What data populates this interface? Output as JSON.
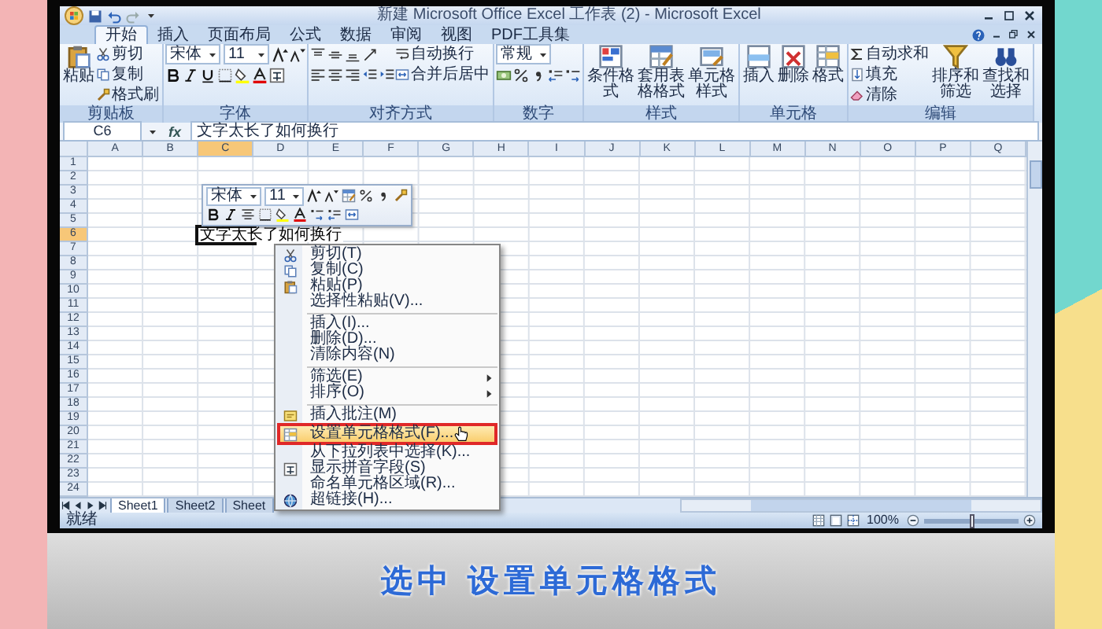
{
  "window": {
    "title": "新建 Microsoft Office Excel 工作表 (2) - Microsoft Excel"
  },
  "tabs": [
    {
      "label": "开始",
      "selected": true
    },
    {
      "label": "插入",
      "selected": false
    },
    {
      "label": "页面布局",
      "selected": false
    },
    {
      "label": "公式",
      "selected": false
    },
    {
      "label": "数据",
      "selected": false
    },
    {
      "label": "审阅",
      "selected": false
    },
    {
      "label": "视图",
      "selected": false
    },
    {
      "label": "PDF工具集",
      "selected": false
    }
  ],
  "ribbon": {
    "groups": [
      {
        "label": "剪贴板",
        "columns": [
          [
            {
              "kind": "large",
              "label": "粘贴"
            }
          ],
          [
            {
              "kind": "small",
              "label": "剪切"
            },
            {
              "kind": "small",
              "label": "复制"
            },
            {
              "kind": "small",
              "label": "格式刷"
            }
          ]
        ]
      },
      {
        "label": "字体",
        "columns": [
          [
            [
              {
                "kind": "select",
                "value": "宋体"
              },
              {
                "kind": "select",
                "value": "11"
              },
              {
                "kind": "tools"
              }
            ],
            [
              {
                "kind": "tools"
              }
            ]
          ]
        ]
      },
      {
        "label": "对齐方式",
        "columns": [
          [
            [
              {
                "kind": "tools"
              }
            ],
            [
              {
                "kind": "tools"
              }
            ]
          ],
          [
            {
              "kind": "small",
              "label": "自动换行"
            },
            {
              "kind": "small",
              "label": "合并后居中"
            }
          ]
        ]
      },
      {
        "label": "数字",
        "columns": [
          [
            [
              {
                "kind": "select",
                "value": "常规"
              }
            ],
            [
              {
                "kind": "tools"
              }
            ]
          ]
        ]
      },
      {
        "label": "样式",
        "columns": [
          [
            {
              "kind": "large",
              "label": "条件格式"
            }
          ],
          [
            {
              "kind": "large",
              "label": "套用表格格式"
            }
          ],
          [
            {
              "kind": "large",
              "label": "单元格样式"
            }
          ]
        ]
      },
      {
        "label": "单元格",
        "columns": [
          [
            {
              "kind": "large",
              "label": "插入"
            }
          ],
          [
            {
              "kind": "large",
              "label": "删除"
            }
          ],
          [
            {
              "kind": "large",
              "label": "格式"
            }
          ]
        ]
      },
      {
        "label": "编辑",
        "columns": [
          [
            {
              "kind": "small",
              "label": "自动求和"
            },
            {
              "kind": "small",
              "label": "填充"
            },
            {
              "kind": "small",
              "label": "清除"
            }
          ],
          [
            {
              "kind": "large",
              "label": "排序和筛选"
            }
          ],
          [
            {
              "kind": "large",
              "label": "查找和选择"
            }
          ]
        ]
      }
    ]
  },
  "formula_bar": {
    "name_box": "C6",
    "function_button": "fx",
    "content": "文字太长了如何换行"
  },
  "grid": {
    "columns": [
      {
        "label": "A",
        "selected": false
      },
      {
        "label": "B",
        "selected": false
      },
      {
        "label": "C",
        "selected": true
      },
      {
        "label": "D",
        "selected": false
      },
      {
        "label": "E",
        "selected": false
      },
      {
        "label": "F",
        "selected": false
      },
      {
        "label": "G",
        "selected": false
      },
      {
        "label": "H",
        "selected": false
      },
      {
        "label": "I",
        "selected": false
      },
      {
        "label": "J",
        "selected": false
      },
      {
        "label": "K",
        "selected": false
      },
      {
        "label": "L",
        "selected": false
      },
      {
        "label": "M",
        "selected": false
      },
      {
        "label": "N",
        "selected": false
      },
      {
        "label": "O",
        "selected": false
      },
      {
        "label": "P",
        "selected": false
      },
      {
        "label": "Q",
        "selected": false
      }
    ],
    "rows": [
      {
        "label": "1",
        "selected": false
      },
      {
        "label": "2",
        "selected": false
      },
      {
        "label": "3",
        "selected": false
      },
      {
        "label": "4",
        "selected": false
      },
      {
        "label": "5",
        "selected": false
      },
      {
        "label": "6",
        "selected": true
      },
      {
        "label": "7",
        "selected": false
      },
      {
        "label": "8",
        "selected": false
      },
      {
        "label": "9",
        "selected": false
      },
      {
        "label": "10",
        "selected": false
      },
      {
        "label": "11",
        "selected": false
      },
      {
        "label": "12",
        "selected": false
      },
      {
        "label": "13",
        "selected": false
      },
      {
        "label": "14",
        "selected": false
      },
      {
        "label": "15",
        "selected": false
      },
      {
        "label": "16",
        "selected": false
      },
      {
        "label": "17",
        "selected": false
      },
      {
        "label": "18",
        "selected": false
      },
      {
        "label": "19",
        "selected": false
      },
      {
        "label": "20",
        "selected": false
      },
      {
        "label": "21",
        "selected": false
      },
      {
        "label": "22",
        "selected": false
      },
      {
        "label": "23",
        "selected": false
      },
      {
        "label": "24",
        "selected": false
      }
    ],
    "active_cell": {
      "text": "文字太长了如何换行"
    }
  },
  "mini_toolbar": {
    "font": "宋体",
    "size": "11"
  },
  "context_menu": {
    "items": [
      {
        "kind": "item",
        "label": "剪切(T)",
        "submenu": false,
        "selected": false
      },
      {
        "kind": "item",
        "label": "复制(C)",
        "submenu": false,
        "selected": false
      },
      {
        "kind": "item",
        "label": "粘贴(P)",
        "submenu": false,
        "selected": false
      },
      {
        "kind": "item",
        "label": "选择性粘贴(V)...",
        "submenu": false,
        "selected": false
      },
      {
        "kind": "separator"
      },
      {
        "kind": "item",
        "label": "插入(I)...",
        "submenu": false,
        "selected": false
      },
      {
        "kind": "item",
        "label": "删除(D)...",
        "submenu": false,
        "selected": false
      },
      {
        "kind": "item",
        "label": "清除内容(N)",
        "submenu": false,
        "selected": false
      },
      {
        "kind": "separator"
      },
      {
        "kind": "item",
        "label": "筛选(E)",
        "submenu": true,
        "selected": false
      },
      {
        "kind": "item",
        "label": "排序(O)",
        "submenu": true,
        "selected": false
      },
      {
        "kind": "separator"
      },
      {
        "kind": "item",
        "label": "插入批注(M)",
        "submenu": false,
        "selected": false
      },
      {
        "kind": "item",
        "label": "设置单元格格式(F)...",
        "submenu": false,
        "selected": true
      },
      {
        "kind": "item",
        "label": "从下拉列表中选择(K)...",
        "submenu": false,
        "selected": false
      },
      {
        "kind": "item",
        "label": "显示拼音字段(S)",
        "submenu": false,
        "selected": false
      },
      {
        "kind": "item",
        "label": "命名单元格区域(R)...",
        "submenu": false,
        "selected": false
      },
      {
        "kind": "item",
        "label": "超链接(H)...",
        "submenu": false,
        "selected": false
      }
    ]
  },
  "sheet_tabs": [
    {
      "label": "Sheet1",
      "selected": true
    },
    {
      "label": "Sheet2",
      "selected": false
    },
    {
      "label": "Sheet",
      "selected": false
    }
  ],
  "status_bar": {
    "status": "就绪",
    "zoom": {
      "label": "100%",
      "level": 0.5
    }
  },
  "caption": "选中 设置单元格格式"
}
